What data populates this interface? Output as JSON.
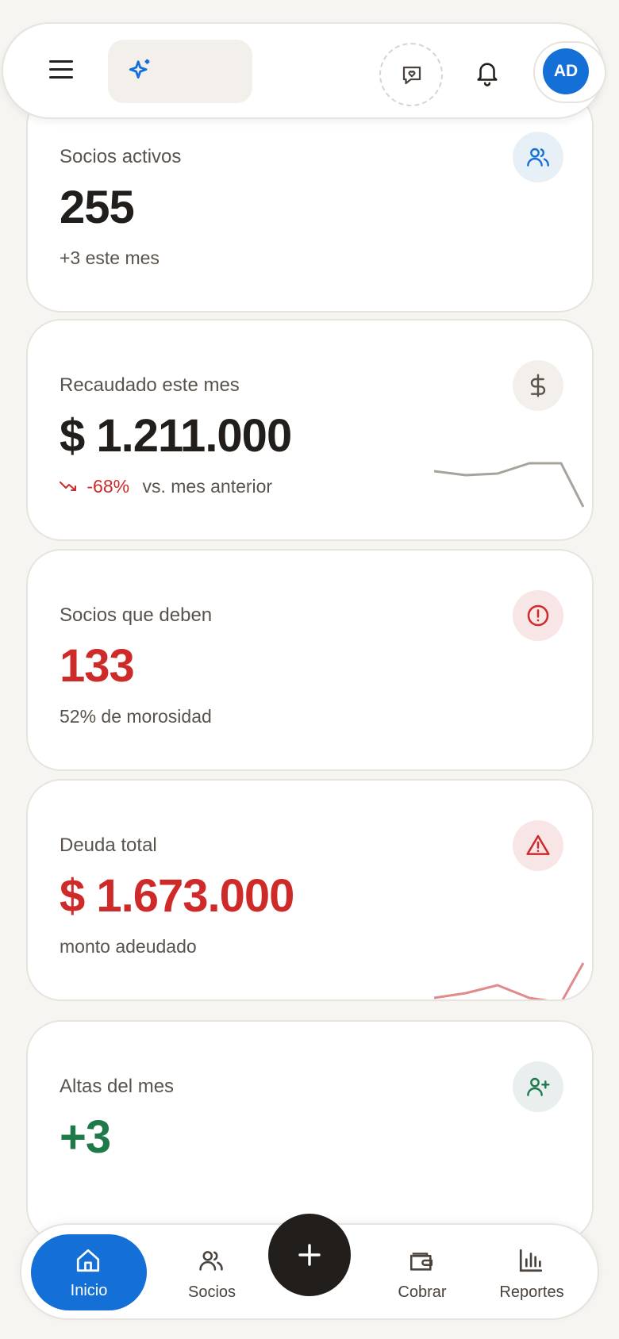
{
  "header": {
    "avatar_initials": "AD",
    "icons": [
      "menu-icon",
      "sparkle-icon",
      "chat-heart-icon",
      "bell-icon"
    ]
  },
  "cards": [
    {
      "label": "Socios activos",
      "value": "255",
      "sub": "+3 este mes",
      "icon": "users-icon",
      "icon_color": "#1470d6",
      "icon_bg": "#e6f0f6"
    },
    {
      "label": "Recaudado este mes",
      "value": "$ 1.211.000",
      "trend_pct": "-68%",
      "trend_text": "vs. mes anterior",
      "icon": "dollar-icon",
      "icon_color": "#5a524c",
      "icon_bg": "#f3efeb"
    },
    {
      "label": "Socios que deben",
      "value": "133",
      "sub": "52% de morosidad",
      "icon": "alert-circle-icon",
      "icon_color": "#cf2a2a",
      "icon_bg": "#f8e6e6"
    },
    {
      "label": "Deuda total",
      "value": "$ 1.673.000",
      "sub": "monto adeudado",
      "icon": "warning-icon",
      "icon_color": "#cf2a2a",
      "icon_bg": "#f8e6e6"
    },
    {
      "label": "Altas del mes",
      "value": "+3",
      "icon": "user-plus-icon",
      "icon_color": "#1f7a4a",
      "icon_bg": "#e8efee"
    }
  ],
  "nav": {
    "items": [
      {
        "label": "Inicio",
        "icon": "home-icon"
      },
      {
        "label": "Socios",
        "icon": "users-icon"
      },
      {
        "label": "Cobrar",
        "icon": "wallet-icon"
      },
      {
        "label": "Reportes",
        "icon": "bar-chart-icon"
      }
    ],
    "fab_icon": "plus-icon"
  },
  "colors": {
    "accent": "#1470d6",
    "danger": "#cf2a2a",
    "success": "#1f7a4a",
    "text": "#221e1b"
  }
}
